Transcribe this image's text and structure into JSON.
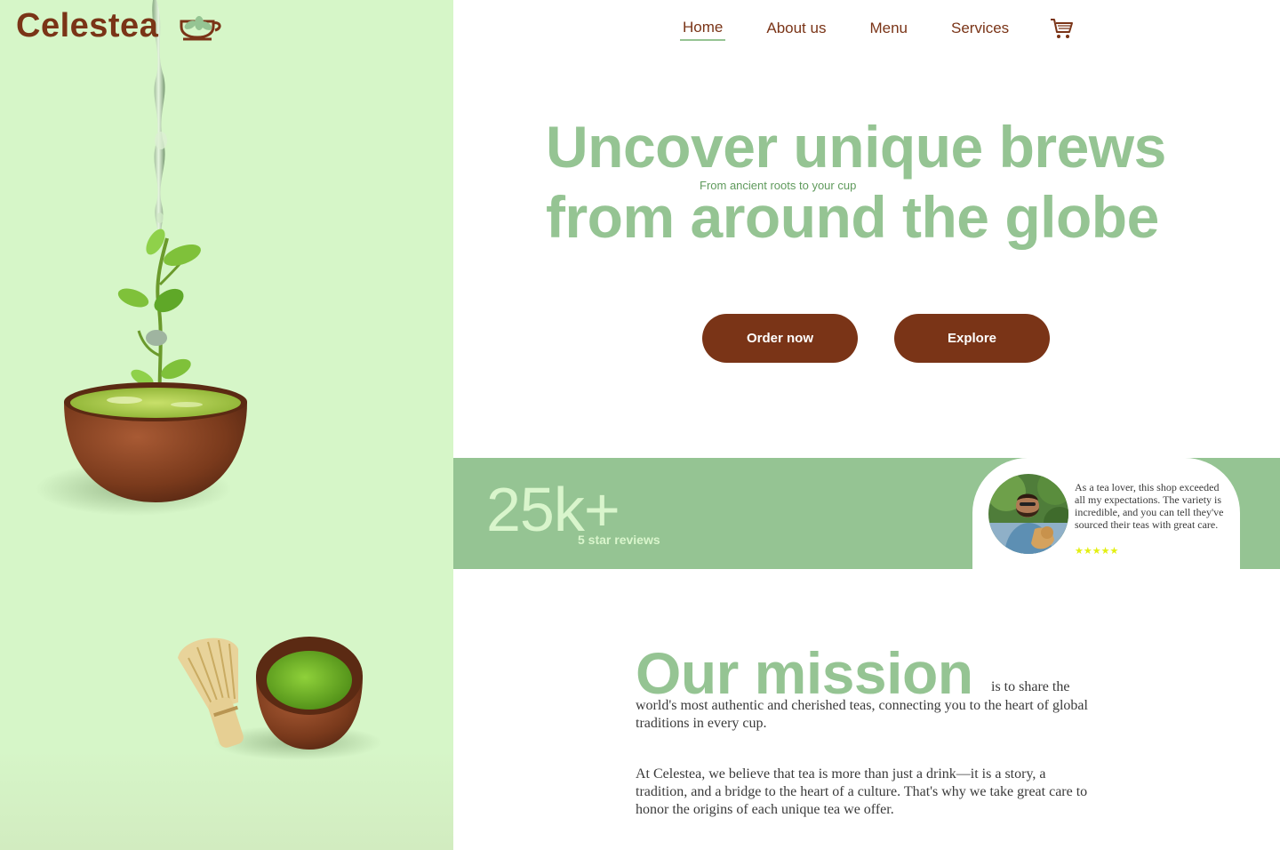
{
  "brand": {
    "name": "Celestea"
  },
  "nav": {
    "items": [
      {
        "label": "Home",
        "active": true
      },
      {
        "label": "About us",
        "active": false
      },
      {
        "label": "Menu",
        "active": false
      },
      {
        "label": "Services",
        "active": false
      }
    ],
    "cart_icon": "shopping-cart-icon"
  },
  "hero": {
    "title_line1": "Uncover unique brews",
    "title_line2": "from around the globe",
    "subtitle": "From ancient roots to your cup",
    "primary_button": "Order now",
    "secondary_button": "Explore"
  },
  "stats": {
    "number": "25k+",
    "label": "5 star reviews",
    "review": {
      "text": "As a tea lover, this shop exceeded all my expectations. The variety is incredible, and you can tell they've sourced their teas with great care.",
      "stars": "★★★★★",
      "rating": 5
    }
  },
  "mission": {
    "title": "Our mission",
    "inline": "is to share the",
    "rest": "world's most authentic and cherished teas, connecting you to the heart of global traditions in every cup.",
    "body": "At Celestea, we believe that tea is more than just a drink—it is a story, a tradition, and a bridge to the heart of a culture. That's why we take great care to honor the origins of each unique tea we offer."
  },
  "colors": {
    "brand_brown": "#7a3417",
    "accent_green": "#95c493",
    "panel_green": "#d6f6c8",
    "star_yellow": "#e3ef12"
  }
}
